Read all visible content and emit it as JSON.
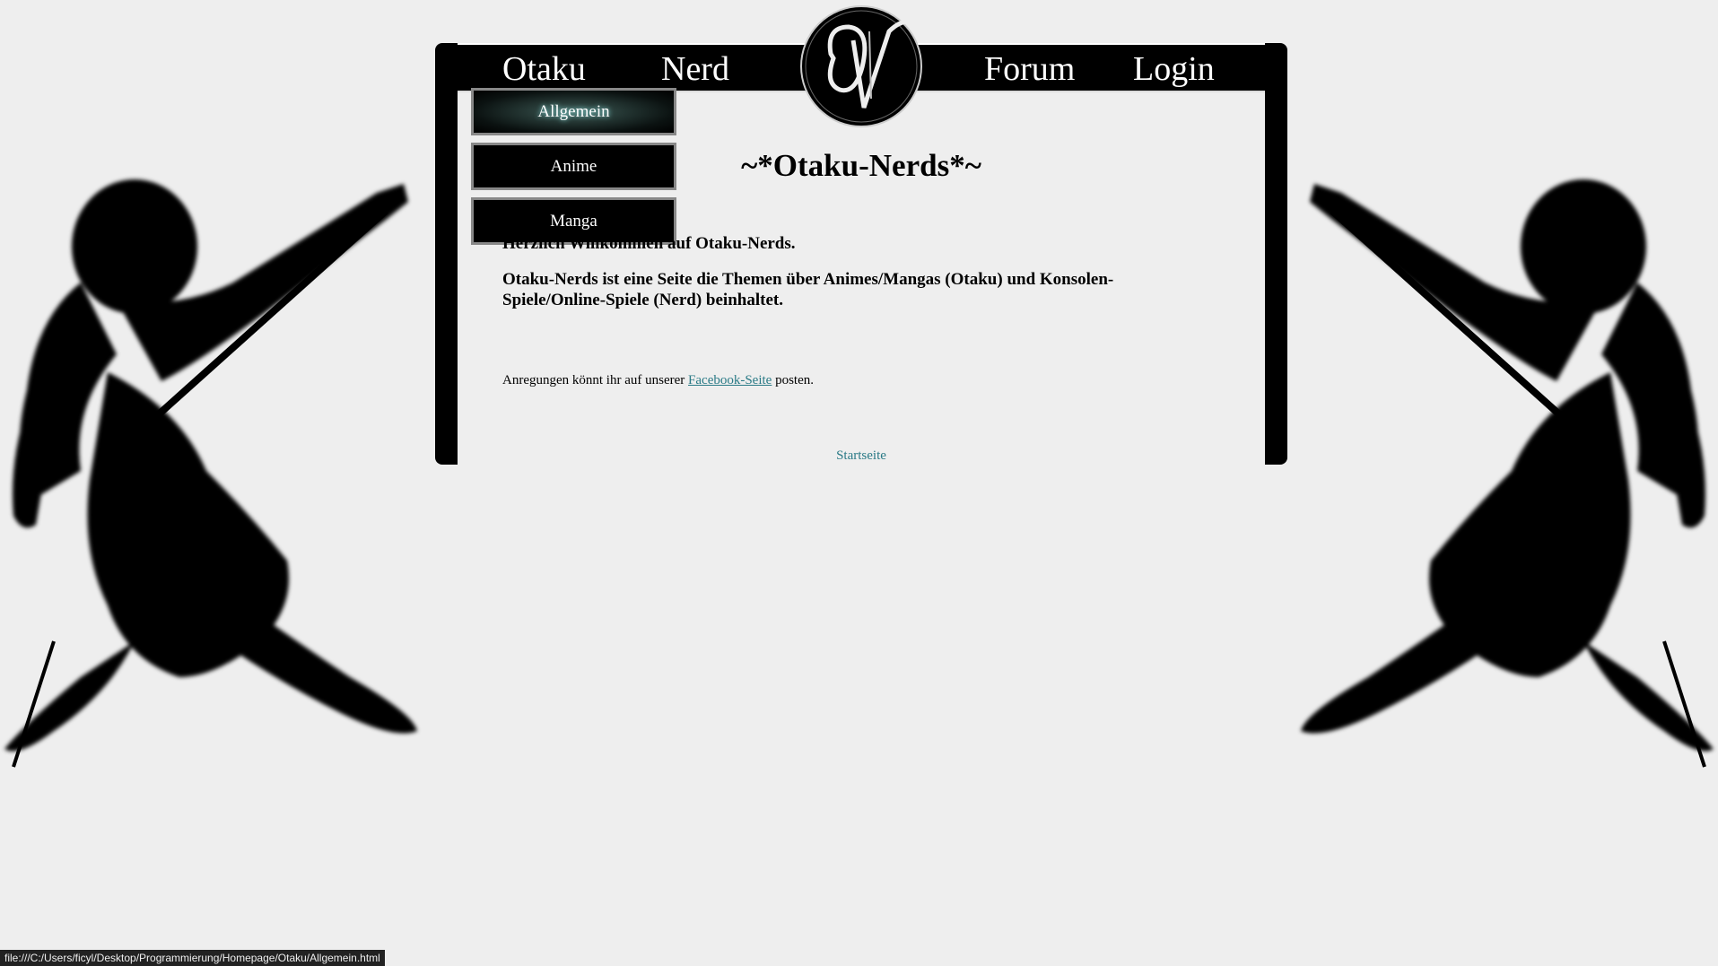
{
  "nav": {
    "left": [
      "Otaku",
      "Nerd"
    ],
    "right": [
      "Forum",
      "Login"
    ]
  },
  "logo_icon": "calligraphic-ON-logo",
  "dropdown": {
    "items": [
      "Allgemein",
      "Anime",
      "Manga"
    ],
    "active": "Allgemein"
  },
  "main": {
    "title": "~*Otaku-Nerds*~",
    "welcome": "Herzlich Willkommen auf Otaku-Nerds.",
    "description": "Otaku-Nerds ist eine Seite die Themen über Animes/Mangas (Otaku) und Konsolen-Spiele/Online-Spiele (Nerd) beinhaltet.",
    "suggest_prefix": "Anregungen könnt ihr auf unserer ",
    "suggest_link": "Facebook-Seite",
    "suggest_suffix": " posten.",
    "home_link": "Startseite"
  },
  "statusbar": {
    "url": "file:///C:/Users/ficyl/Desktop/Programmierung/Homepage/Otaku/Allgemein.html"
  },
  "colors": {
    "background": "#eeeeee",
    "frame": "#000000",
    "link": "#2a7a86"
  }
}
